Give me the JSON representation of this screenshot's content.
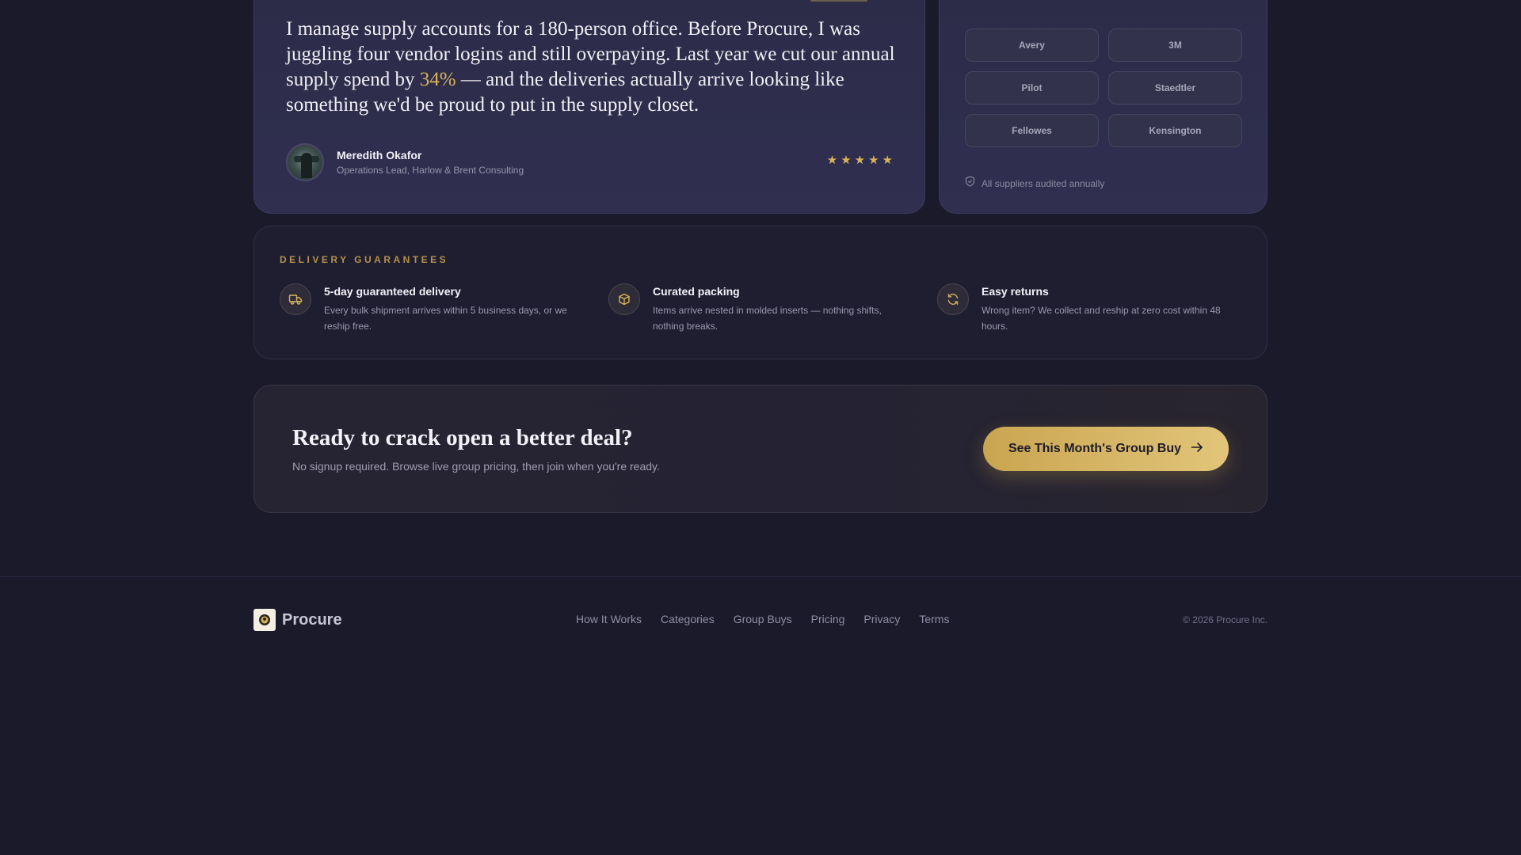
{
  "testimonial": {
    "quote_before": "I manage supply accounts for a 180-person office. Before Procure, I was juggling four vendor logins and still overpaying. Last year we cut our annual supply spend by ",
    "quote_highlight": "34%",
    "quote_after": " — and the deliveries actually arrive looking like something we'd be proud to put in the supply closet.",
    "author_name": "Meredith Okafor",
    "author_role": "Operations Lead, Harlow & Brent Consulting",
    "rating": 5,
    "star_glyph": "★"
  },
  "suppliers": {
    "items": [
      "Avery",
      "3M",
      "Pilot",
      "Staedtler",
      "Fellowes",
      "Kensington"
    ],
    "audit_note": "All suppliers audited annually"
  },
  "delivery": {
    "title": "DELIVERY GUARANTEES",
    "features": [
      {
        "icon": "truck-icon",
        "title": "5-day guaranteed delivery",
        "desc": "Every bulk shipment arrives within 5 business days, or we reship free."
      },
      {
        "icon": "box-icon",
        "title": "Curated packing",
        "desc": "Items arrive nested in molded inserts — nothing shifts, nothing breaks."
      },
      {
        "icon": "refresh-icon",
        "title": "Easy returns",
        "desc": "Wrong item? We collect and reship at zero cost within 48 hours."
      }
    ]
  },
  "cta": {
    "title": "Ready to crack open a better deal?",
    "subtitle": "No signup required. Browse live group pricing, then join when you're ready.",
    "button_label": "See This Month's Group Buy"
  },
  "footer": {
    "brand": "Procure",
    "nav": [
      "How It Works",
      "Categories",
      "Group Buys",
      "Pricing",
      "Privacy",
      "Terms"
    ],
    "copyright": "© 2026 Procure Inc."
  },
  "colors": {
    "accent_gold": "#d8b45a",
    "background": "#1a1a2b",
    "card": "#2c2b48"
  }
}
